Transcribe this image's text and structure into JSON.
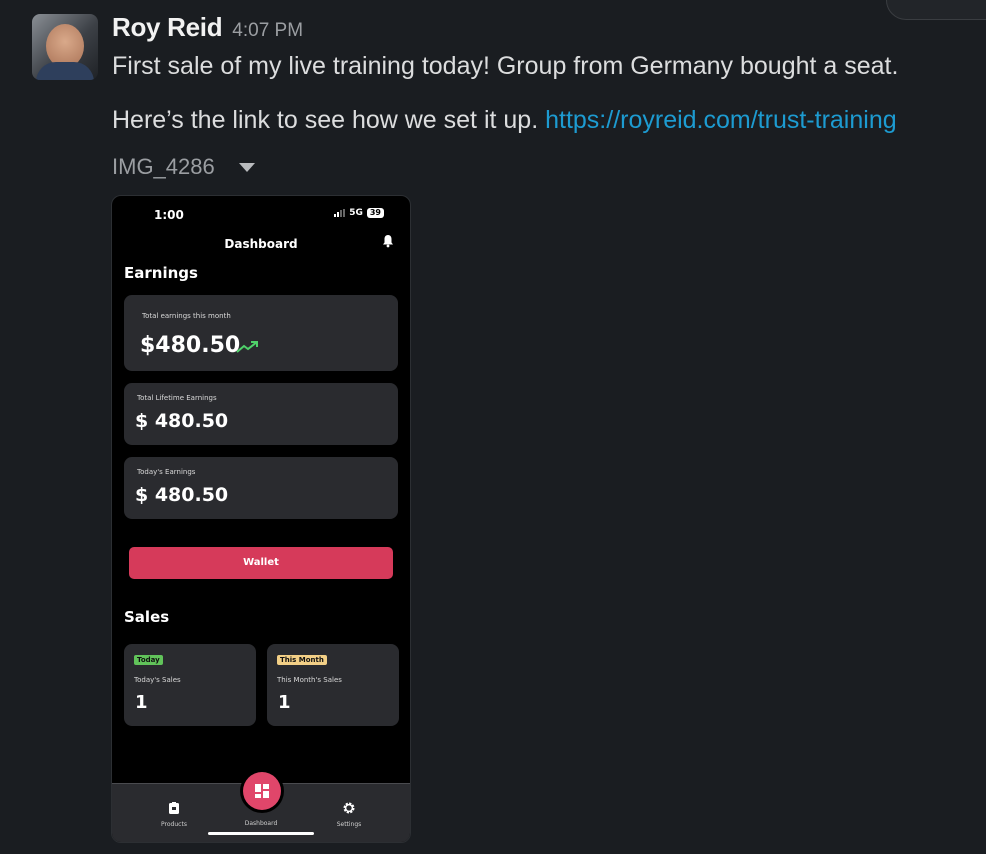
{
  "message": {
    "sender": "Roy Reid",
    "time": "4:07 PM",
    "text_line1": "First sale of my live training today! Group from Germany bought a seat.",
    "text_line2": "Here’s the link to see how we set it up.",
    "link": "https://royreid.com/trust-training",
    "attachment_name": "IMG_4286"
  },
  "phone": {
    "status_time": "1:00",
    "network": "5G",
    "battery": "39",
    "title": "Dashboard",
    "earnings_heading": "Earnings",
    "cards": [
      {
        "label": "Total earnings this month",
        "value": "$480.50"
      },
      {
        "label": "Total Lifetime Earnings",
        "value": "$ 480.50"
      },
      {
        "label": "Today's Earnings",
        "value": "$ 480.50"
      }
    ],
    "wallet_label": "Wallet",
    "sales_heading": "Sales",
    "sales": [
      {
        "badge": "Today",
        "label": "Today's Sales",
        "value": "1"
      },
      {
        "badge": "This Month",
        "label": "This Month's Sales",
        "value": "1"
      }
    ],
    "tabs": [
      {
        "label": "Products"
      },
      {
        "label": "Dashboard"
      },
      {
        "label": "Settings"
      }
    ],
    "colors": {
      "accent": "#d63a5a",
      "today_badge": "#61c35a",
      "month_badge": "#f2cf86",
      "trend": "#4fd16a"
    }
  }
}
